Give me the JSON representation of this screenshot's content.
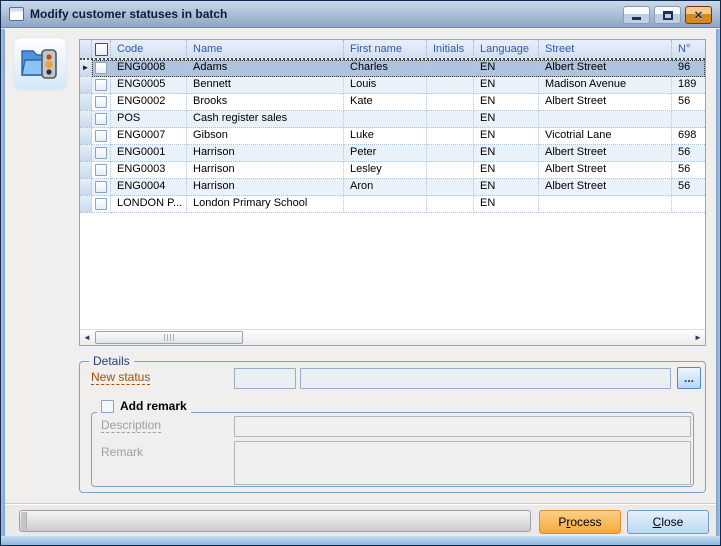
{
  "window": {
    "title": "Modify customer statuses in batch"
  },
  "grid": {
    "columns": [
      "Code",
      "Name",
      "First name",
      "Initials",
      "Language",
      "Street",
      "N°"
    ],
    "rows": [
      {
        "code": "ENG0008",
        "name": "Adams",
        "first_name": "Charles",
        "initials": "",
        "language": "EN",
        "street": "Albert Street",
        "nr": "96",
        "selected": true
      },
      {
        "code": "ENG0005",
        "name": "Bennett",
        "first_name": "Louis",
        "initials": "",
        "language": "EN",
        "street": "Madison Avenue",
        "nr": "189"
      },
      {
        "code": "ENG0002",
        "name": "Brooks",
        "first_name": "Kate",
        "initials": "",
        "language": "EN",
        "street": "Albert Street",
        "nr": "56"
      },
      {
        "code": "POS",
        "name": "Cash register sales",
        "first_name": "",
        "initials": "",
        "language": "EN",
        "street": "",
        "nr": ""
      },
      {
        "code": "ENG0007",
        "name": "Gibson",
        "first_name": "Luke",
        "initials": "",
        "language": "EN",
        "street": "Vicotrial Lane",
        "nr": "698"
      },
      {
        "code": "ENG0001",
        "name": "Harrison",
        "first_name": "Peter",
        "initials": "",
        "language": "EN",
        "street": "Albert Street",
        "nr": "56"
      },
      {
        "code": "ENG0003",
        "name": "Harrison",
        "first_name": "Lesley",
        "initials": "",
        "language": "EN",
        "street": "Albert Street",
        "nr": "56"
      },
      {
        "code": "ENG0004",
        "name": "Harrison",
        "first_name": "Aron",
        "initials": "",
        "language": "EN",
        "street": "Albert Street",
        "nr": "56"
      },
      {
        "code": "LONDON P...",
        "name": "London Primary School",
        "first_name": "",
        "initials": "",
        "language": "EN",
        "street": "",
        "nr": ""
      }
    ]
  },
  "details": {
    "group_label": "Details",
    "new_status_label": "New status",
    "new_status_code_value": "",
    "new_status_name_value": "",
    "browse_button_label": "...",
    "add_remark_label": "Add remark",
    "add_remark_checked": false,
    "description_label": "Description",
    "description_value": "",
    "remark_label": "Remark",
    "remark_value": ""
  },
  "footer": {
    "process": {
      "pre": "P",
      "mnemonic": "r",
      "post": "ocess"
    },
    "close": {
      "pre": "",
      "mnemonic": "C",
      "post": "lose"
    }
  },
  "icons": {
    "titlebar_icon": "form-window-icon",
    "app_icon": "folder-with-status-traffic-light-icon",
    "current_row_marker": "right-arrow-icon"
  },
  "colors": {
    "titlebar-top": "#cbd8e8",
    "titlebar-bottom": "#8ea6c6",
    "selected-row": "#aec3de",
    "alt-row": "#e9f1fa",
    "header-text": "#3059a8",
    "new-status": "#a84f00",
    "process-top": "#fccf86",
    "process-bottom": "#f6a93e",
    "process-border": "#dd8f33",
    "close-border": "#709cc9"
  }
}
